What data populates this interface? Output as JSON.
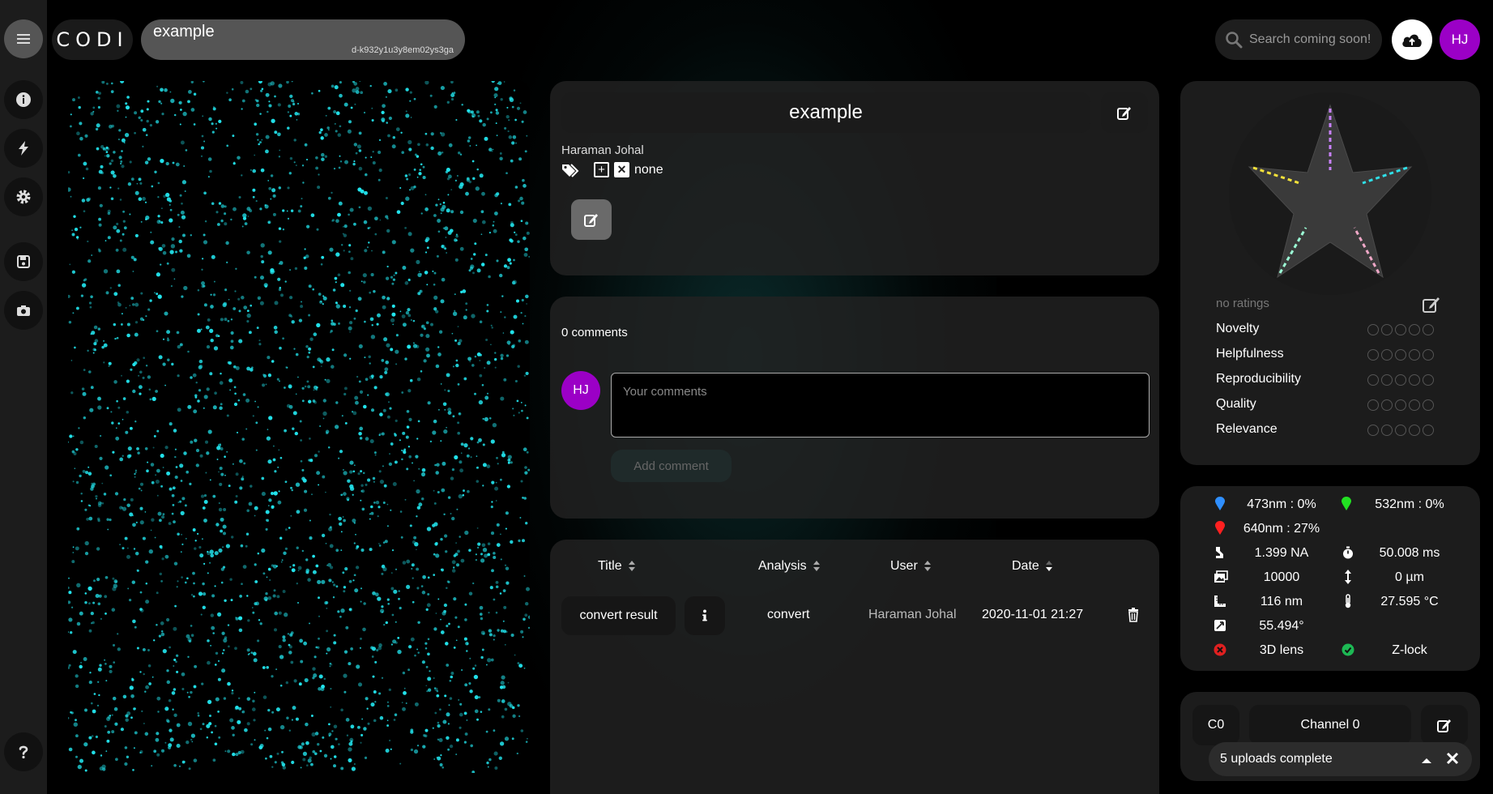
{
  "app": {
    "logo": "CODI"
  },
  "header": {
    "dataset_title": "example",
    "dataset_id": "d-k932y1u3y8em02ys3ga",
    "search_placeholder": "Search coming soon!",
    "user_initials": "HJ"
  },
  "sidebar": {
    "items": [
      "menu-icon",
      "info-icon",
      "bolt-icon",
      "gear-icon",
      "save-icon",
      "camera-icon",
      "help-icon"
    ]
  },
  "details": {
    "title": "example",
    "author": "Haraman Johal",
    "tags_value": "none"
  },
  "comments": {
    "count_label": "0 comments",
    "avatar_initials": "HJ",
    "placeholder": "Your comments",
    "add_label": "Add comment"
  },
  "analysis_table": {
    "headers": {
      "title": "Title",
      "analysis": "Analysis",
      "user": "User",
      "date": "Date"
    },
    "rows": [
      {
        "title": "convert result",
        "analysis": "convert",
        "user": "Haraman Johal",
        "date": "2020-11-01 21:27"
      }
    ]
  },
  "ratings": {
    "empty_label": "no ratings",
    "categories": [
      "Novelty",
      "Helpfulness",
      "Reproducibility",
      "Quality",
      "Relevance"
    ],
    "values": [
      0,
      0,
      0,
      0,
      0
    ],
    "max": 5,
    "star_colors": [
      "#c982ff",
      "#2fe0e8",
      "#f0a8c8",
      "#9cffd6",
      "#f5e23a"
    ]
  },
  "metadata": {
    "laser_473": "473nm : 0%",
    "laser_532": "532nm : 0%",
    "laser_640": "640nm : 27%",
    "na": "1.399 NA",
    "exposure": "50.008 ms",
    "frames": "10000",
    "z_step": "0 µm",
    "pixel_size": "116 nm",
    "temperature": "27.595 °C",
    "angle": "55.494°",
    "lens_3d": "3D lens",
    "zlock": "Z-lock",
    "colors": {
      "blue": "#2f8fff",
      "green": "#22e022",
      "red": "#ff2020",
      "ok": "#1db954",
      "err": "#e02020"
    }
  },
  "channel": {
    "code": "C0",
    "name": "Channel 0"
  },
  "toast": {
    "text": "5 uploads complete"
  },
  "theme": {
    "accent_purple": "#9b00c6",
    "cyan": "#22e5ee"
  }
}
